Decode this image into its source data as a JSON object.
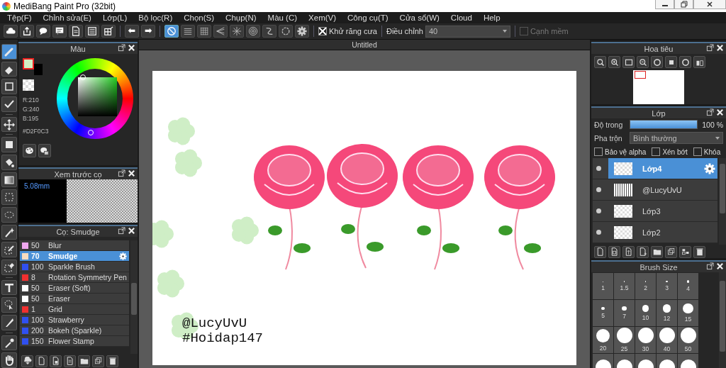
{
  "window": {
    "title": "MediBang Paint Pro (32bit)"
  },
  "menu": [
    "Tệp(F)",
    "Chỉnh sửa(E)",
    "Lớp(L)",
    "Bộ lọc(R)",
    "Chọn(S)",
    "Chụp(N)",
    "Màu (C)",
    "Xem(V)",
    "Công cụ(T)",
    "Cửa sổ(W)",
    "Cloud",
    "Help"
  ],
  "toolbar": {
    "snaps": [
      {
        "selected": true
      },
      {
        "selected": false
      },
      {
        "selected": false
      },
      {
        "selected": false
      },
      {
        "selected": false
      },
      {
        "selected": false
      },
      {
        "selected": false
      },
      {
        "selected": false
      }
    ],
    "antialias": {
      "label": "Khử răng cưa",
      "checked": true
    },
    "correction": {
      "label": "Điều chỉnh",
      "value": "40"
    },
    "soft_edge": {
      "label": "Cạnh mềm",
      "checked": false
    }
  },
  "tools": [
    {
      "kind": "brush",
      "selected": true
    },
    {
      "kind": "eraser",
      "selected": false
    },
    {
      "kind": "rect",
      "selected": false
    },
    {
      "kind": "line",
      "selected": false
    },
    {
      "kind": "move",
      "selected": false
    },
    {
      "kind": "fill",
      "selected": false
    },
    {
      "kind": "bucket",
      "selected": false
    },
    {
      "kind": "gradient",
      "selected": false
    },
    {
      "kind": "select",
      "selected": false
    },
    {
      "kind": "lasso",
      "selected": false
    },
    {
      "kind": "wand",
      "selected": false
    },
    {
      "kind": "selpen",
      "selected": false
    },
    {
      "kind": "selerase",
      "selected": false
    },
    {
      "kind": "text",
      "selected": false
    },
    {
      "kind": "operate",
      "selected": false
    },
    {
      "kind": "divide",
      "selected": false
    },
    {
      "kind": "dropper",
      "selected": false
    },
    {
      "kind": "hand",
      "selected": false
    }
  ],
  "color_panel": {
    "title": "Màu",
    "color": "#d2f0c3",
    "rgb": [
      "R:210",
      "G:240",
      "B:195"
    ],
    "hex": "#D2F0C3"
  },
  "brush_preview": {
    "title": "Xem trước cọ",
    "size": "5.08mm"
  },
  "brush_panel": {
    "title": "Cọ: Smudge",
    "brushes": [
      {
        "size": "50",
        "name": "Blur",
        "color": "#f0a8f0",
        "selected": false
      },
      {
        "size": "70",
        "name": "Smudge",
        "color": "#f8dcc0",
        "selected": true
      },
      {
        "size": "100",
        "name": "Sparkle Brush",
        "color": "#3050f0",
        "selected": false
      },
      {
        "size": "8",
        "name": "Rotation Symmetry Pen",
        "color": "#f03030",
        "selected": false
      },
      {
        "size": "50",
        "name": "Eraser (Soft)",
        "color": "#ffffff",
        "selected": false
      },
      {
        "size": "50",
        "name": "Eraser",
        "color": "#ffffff",
        "selected": false
      },
      {
        "size": "1",
        "name": "Grid",
        "color": "#f03030",
        "selected": false
      },
      {
        "size": "100",
        "name": "Strawberry",
        "color": "#3050f0",
        "selected": false
      },
      {
        "size": "200",
        "name": "Bokeh (Sparkle)",
        "color": "#3050f0",
        "selected": false
      },
      {
        "size": "150",
        "name": "Flower Stamp",
        "color": "#3050f0",
        "selected": false
      }
    ]
  },
  "canvas": {
    "tab": "Untitled",
    "texts": [
      "@LucyUvU",
      "#Hoidap147"
    ]
  },
  "navigator": {
    "title": "Hoa tiêu"
  },
  "layers_panel": {
    "title": "Lớp",
    "opacity_label": "Độ trong",
    "opacity": {
      "level": 1
    },
    "opacity_reading": "100 %",
    "blend_label": "Pha trộn",
    "blend": "Bình thường",
    "options": [
      {
        "label": "Bảo vệ alpha",
        "checked": false
      },
      {
        "label": "Xén bớt",
        "checked": false
      },
      {
        "label": "Khóa",
        "checked": false
      }
    ],
    "layers": [
      {
        "name": "Lớp4",
        "selected": true,
        "kind": "empty"
      },
      {
        "name": "@LucyUvU",
        "selected": false,
        "kind": "text"
      },
      {
        "name": "Lớp3",
        "selected": false,
        "kind": "empty"
      },
      {
        "name": "Lớp2",
        "selected": false,
        "kind": "empty"
      }
    ]
  },
  "brush_size": {
    "title": "Brush Size",
    "sizes": [
      "1",
      "1.5",
      "2",
      "3",
      "4",
      "5",
      "7",
      "10",
      "12",
      "15",
      "20",
      "25",
      "30",
      "40",
      "50"
    ]
  }
}
